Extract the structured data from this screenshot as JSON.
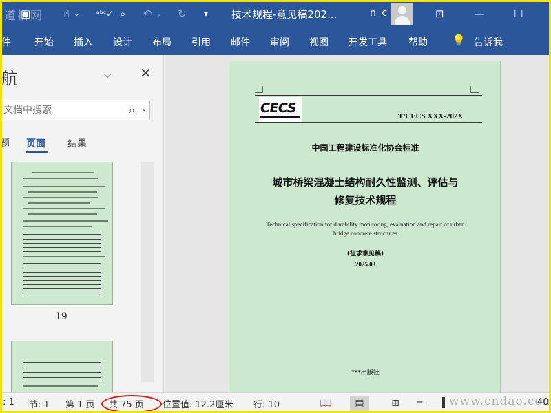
{
  "window": {
    "title": "技术规程-意见稿202...",
    "user_initials": "n c",
    "watermark_top": "道桥网",
    "watermark_bottom": "www.cndao.com"
  },
  "quick_access": [
    {
      "icon": "save-icon",
      "glyph": "💾"
    },
    {
      "icon": "touch-mode-icon",
      "glyph": "☝"
    },
    {
      "icon": "spelling-check-icon",
      "glyph": "ABC"
    },
    {
      "icon": "print-preview-icon",
      "glyph": "🔍"
    },
    {
      "icon": "undo-icon",
      "glyph": "↶"
    },
    {
      "icon": "redo-icon",
      "glyph": "↻"
    },
    {
      "icon": "customize-qat-icon",
      "glyph": "⏷"
    }
  ],
  "ribbon": {
    "tabs": [
      "件",
      "开始",
      "插入",
      "设计",
      "布局",
      "引用",
      "邮件",
      "审阅",
      "视图",
      "开发工具",
      "帮助"
    ],
    "tell_me": "告诉我"
  },
  "nav_pane": {
    "heading": "航",
    "search_placeholder": "文档中搜索",
    "tabs": [
      "题",
      "页面",
      "结果"
    ],
    "active_tab": "页面",
    "page_numbers": [
      "19"
    ]
  },
  "document": {
    "standard_code": "T/CECS XXX-202X",
    "logo_text": "CECS",
    "association": "中国工程建设标准化协会标准",
    "title_line1": "城市桥梁混凝土结构耐久性监测、评估与",
    "title_line2": "修复技术规程",
    "english_line1": "Technical specification for durability monitoring, evaluation and repair of urban",
    "english_line2": "bridge concrete structures",
    "draft_label": "(征求意见稿)",
    "date": "2025.03",
    "publisher": "***出版社"
  },
  "status_bar": {
    "page_info": ":  1",
    "section": "节: 1",
    "page": "第 1 页",
    "total_pages": "共 75 页",
    "position": "位置值: 12.2厘米",
    "line": "行: 10",
    "zoom_suffix": "40"
  },
  "colors": {
    "ribbon_blue": "#2b579a",
    "page_green": "#cce8cf",
    "highlight_red": "#e0151b",
    "frame_yellow": "#f5e400"
  }
}
